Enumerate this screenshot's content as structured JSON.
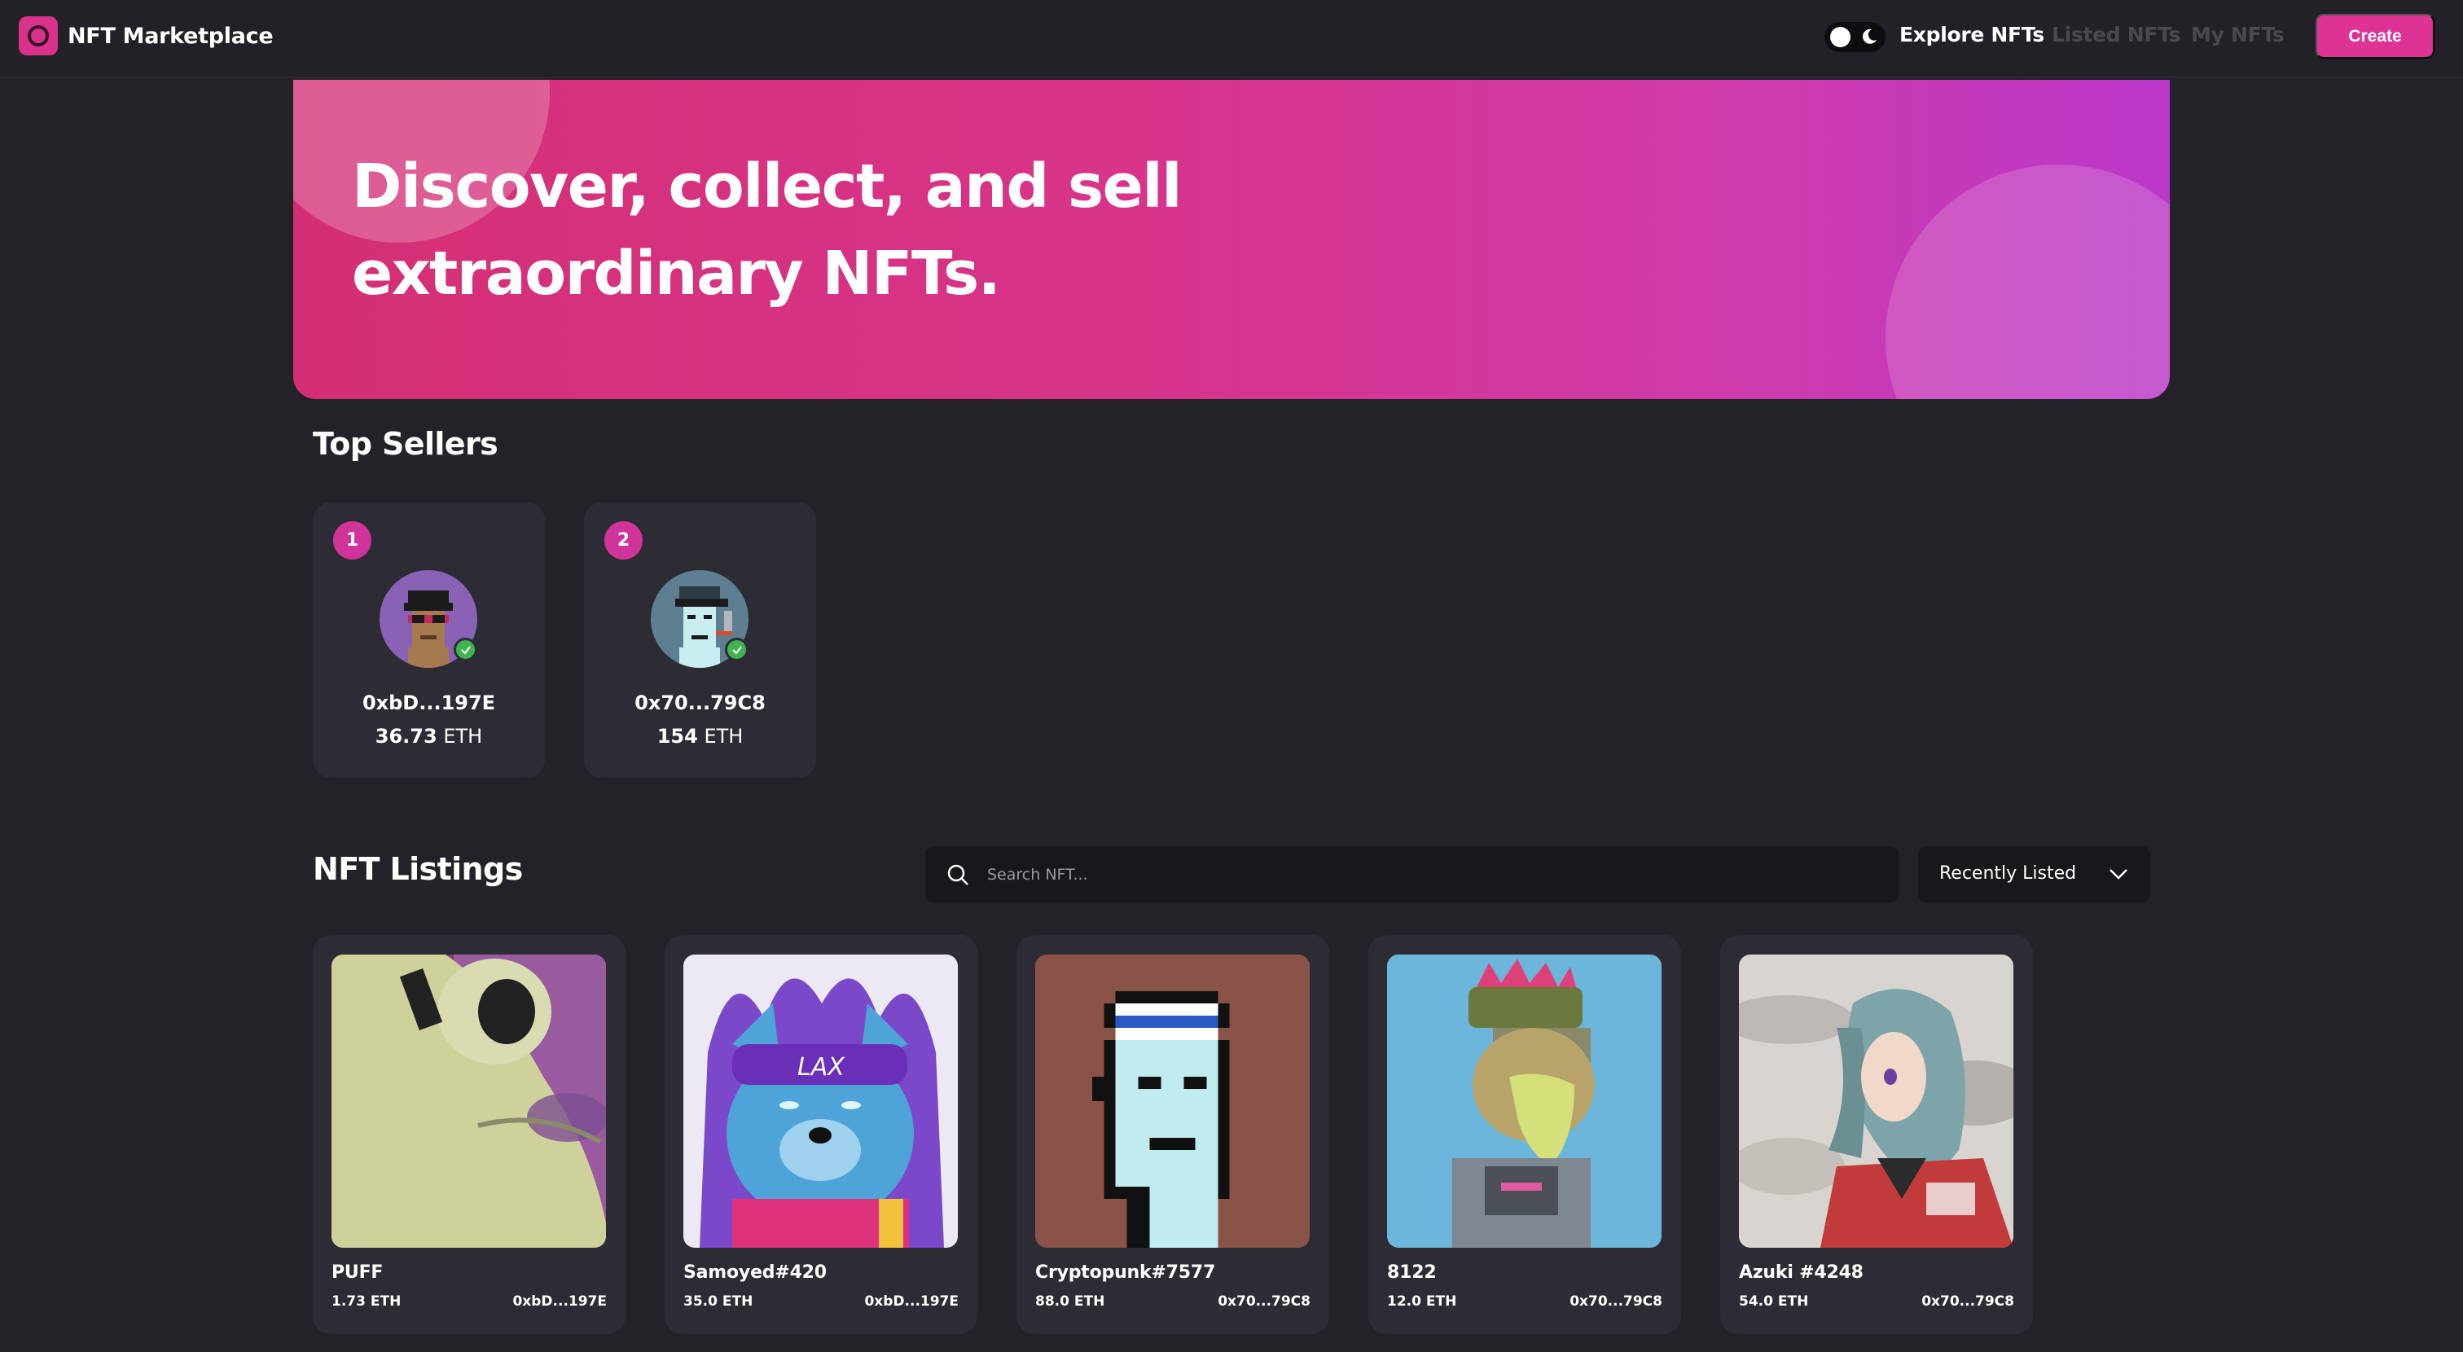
{
  "nav": {
    "brand": "NFT Marketplace",
    "links": [
      "Explore NFTs",
      "Listed NFTs",
      "My NFTs"
    ],
    "create_label": "Create"
  },
  "hero": {
    "line1": "Discover, collect, and sell",
    "line2": "extraordinary NFTs."
  },
  "top_sellers": {
    "title": "Top Sellers",
    "items": [
      {
        "rank": "1",
        "address": "0xbD...197E",
        "amount": "36.73",
        "unit": "ETH"
      },
      {
        "rank": "2",
        "address": "0x70...79C8",
        "amount": "154",
        "unit": "ETH"
      }
    ]
  },
  "listings": {
    "title": "NFT Listings",
    "search_placeholder": "Search NFT...",
    "sort_selected": "Recently Listed",
    "items": [
      {
        "name": "PUFF",
        "price": "1.73 ETH",
        "owner": "0xbD...197E"
      },
      {
        "name": "Samoyed#420",
        "price": "35.0 ETH",
        "owner": "0xbD...197E"
      },
      {
        "name": "Cryptopunk#7577",
        "price": "88.0 ETH",
        "owner": "0x70...79C8"
      },
      {
        "name": "8122",
        "price": "12.0 ETH",
        "owner": "0x70...79C8"
      },
      {
        "name": "Azuki #4248",
        "price": "54.0 ETH",
        "owner": "0x70...79C8"
      }
    ]
  },
  "colors": {
    "accent": "#dc3395",
    "background": "#232228",
    "card": "#2d2c34",
    "verified": "#3fb44e"
  },
  "icons": [
    "theme-toggle-icon",
    "moon-icon",
    "verified-icon",
    "search-icon",
    "chevron-down-icon"
  ]
}
